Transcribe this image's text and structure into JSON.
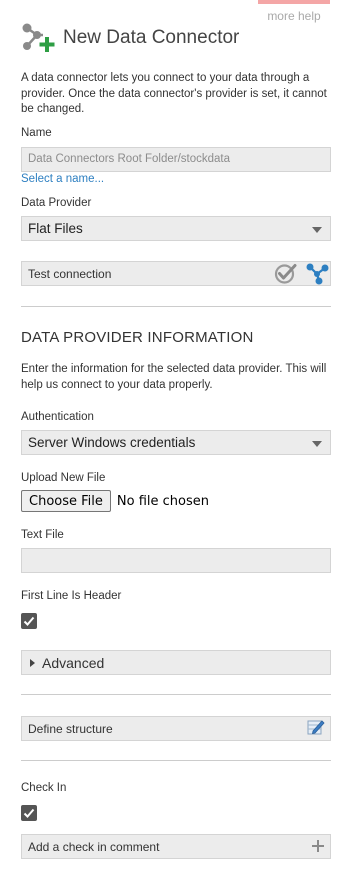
{
  "more_help": "more help",
  "title": "New Data Connector",
  "description": "A data connector lets you connect to your data through a provider. Once the data connector's provider is set, it cannot be changed.",
  "name": {
    "label": "Name",
    "value": "Data Connectors Root Folder/stockdata",
    "select_link": "Select a name..."
  },
  "data_provider": {
    "label": "Data Provider",
    "value": "Flat Files"
  },
  "test_connection": {
    "label": "Test connection"
  },
  "provider_info": {
    "title": "DATA PROVIDER INFORMATION",
    "description": "Enter the information for the selected data provider. This will help us connect to your data properly."
  },
  "authentication": {
    "label": "Authentication",
    "value": "Server Windows credentials"
  },
  "upload": {
    "label": "Upload New File",
    "button": "Choose File",
    "status": "No file chosen"
  },
  "text_file": {
    "label": "Text File",
    "value": ""
  },
  "first_line_header": {
    "label": "First Line Is Header",
    "checked": true
  },
  "advanced": {
    "label": "Advanced"
  },
  "define_structure": {
    "label": "Define structure"
  },
  "check_in": {
    "label": "Check In",
    "checked": true
  },
  "check_in_comment": {
    "label": "Add a check in comment"
  },
  "colors": {
    "accent_blue": "#2d7fc1",
    "field_bg": "#ececec",
    "checkmark_gray": "#888888",
    "plus_green": "#2e9e44"
  },
  "icons": {
    "header": "data-connector-add-icon",
    "test_ok": "check-circle-icon",
    "test_connect": "connection-nodes-icon",
    "define_structure": "edit-structure-icon",
    "add_comment": "plus-icon"
  }
}
